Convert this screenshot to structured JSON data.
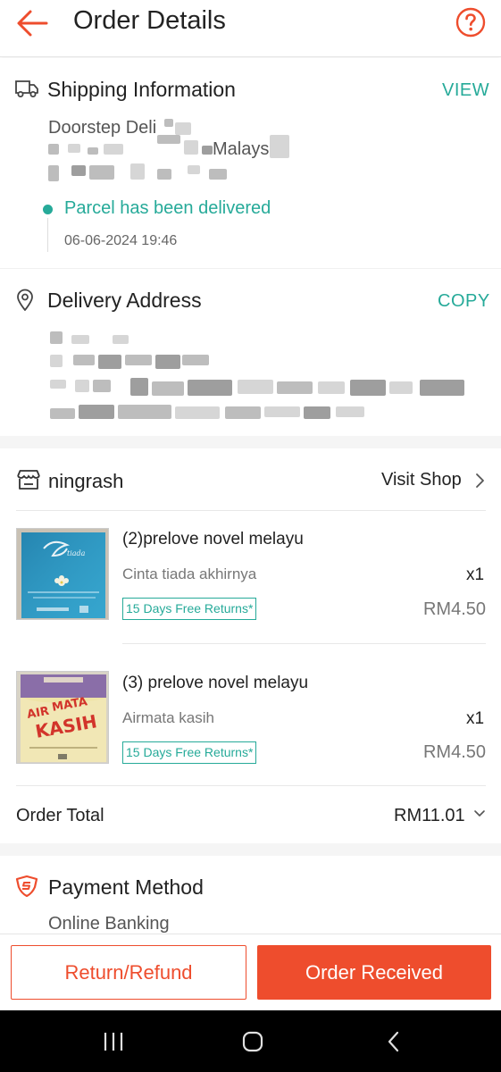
{
  "header": {
    "title": "Order Details",
    "back_icon": "arrow-left-icon",
    "help_icon": "question-circle-icon"
  },
  "shipping": {
    "title": "Shipping Information",
    "action": "VIEW",
    "line1": "Doorstep Deli",
    "line2_fragment": "Malaysi",
    "status": "Parcel has been delivered",
    "timestamp": "06-06-2024 19:46"
  },
  "address": {
    "title": "Delivery Address",
    "action": "COPY"
  },
  "shop": {
    "name": "ningrash",
    "visit_label": "Visit Shop",
    "items": [
      {
        "title": "(2)prelove novel melayu",
        "variant": "Cinta tiada akhirnya",
        "qty": "x1",
        "badge": "15 Days Free Returns*",
        "price": "RM4.50"
      },
      {
        "title": "(3) prelove novel melayu",
        "variant": "Airmata kasih",
        "qty": "x1",
        "badge": "15 Days Free Returns*",
        "price": "RM4.50"
      }
    ],
    "order_total_label": "Order Total",
    "order_total_value": "RM11.01"
  },
  "payment": {
    "title": "Payment Method",
    "value": "Online Banking"
  },
  "actions": {
    "refund": "Return/Refund",
    "received": "Order Received"
  },
  "colors": {
    "brand": "#ee4d2d",
    "teal": "#26aa99"
  }
}
